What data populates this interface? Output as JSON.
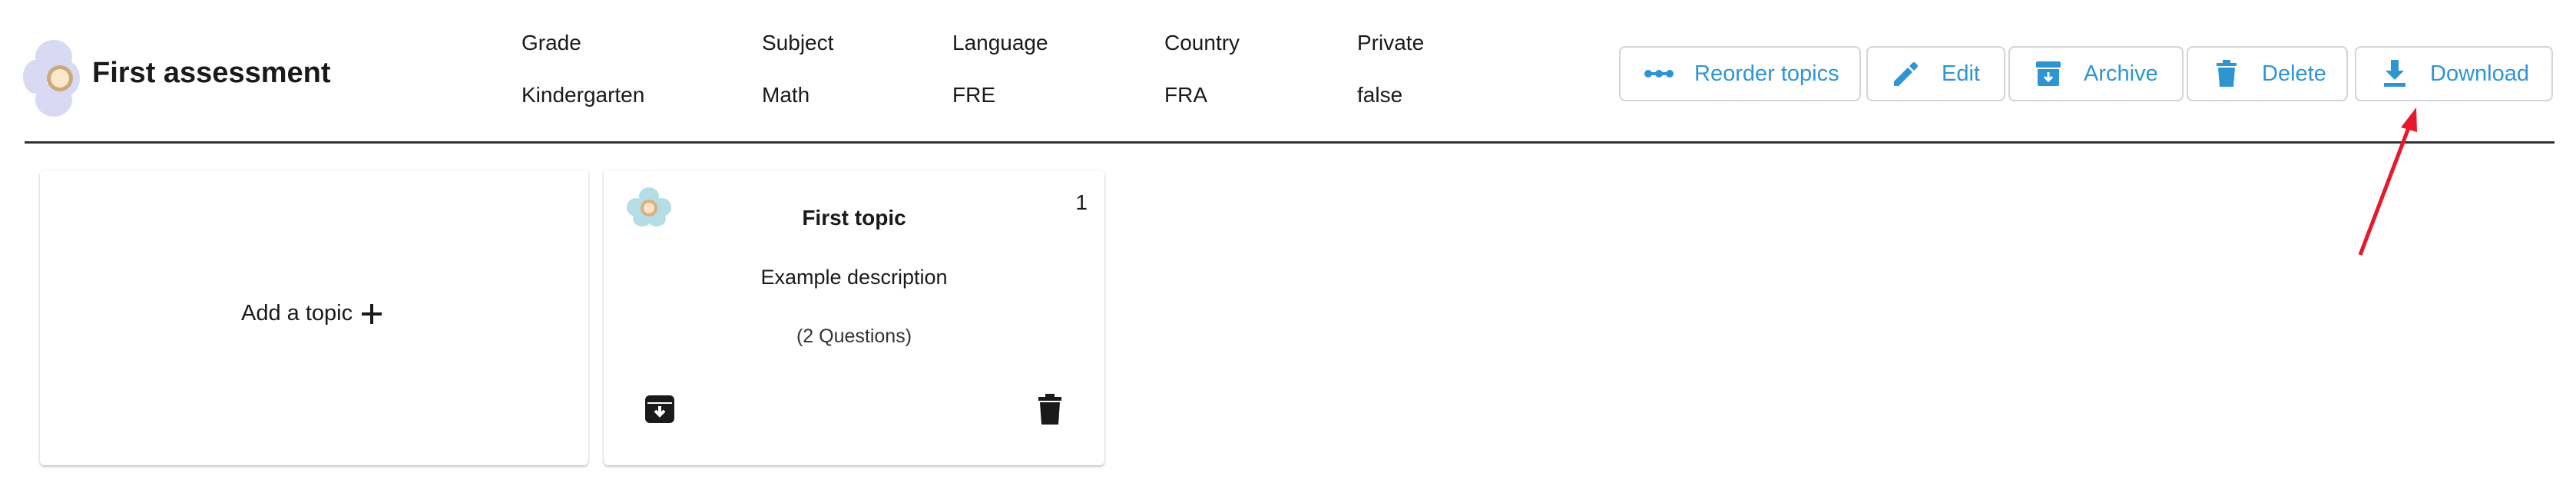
{
  "header": {
    "title": "First assessment",
    "meta": [
      {
        "label": "Grade",
        "value": "Kindergarten"
      },
      {
        "label": "Subject",
        "value": "Math"
      },
      {
        "label": "Language",
        "value": "FRE"
      },
      {
        "label": "Country",
        "value": "FRA"
      },
      {
        "label": "Private",
        "value": "false"
      }
    ]
  },
  "toolbar": {
    "reorder_label": "Reorder topics",
    "edit_label": "Edit",
    "archive_label": "Archive",
    "delete_label": "Delete",
    "download_label": "Download"
  },
  "add_topic": {
    "label": "Add a topic"
  },
  "topics": [
    {
      "title": "First topic",
      "description": "Example description",
      "questions": "(2 Questions)",
      "number": "1"
    }
  ],
  "colors": {
    "accent": "#2e95d3",
    "annotation_arrow": "#e8182b"
  },
  "icons": {
    "reorder": "reorder-icon",
    "edit": "pencil-icon",
    "archive": "archive-icon",
    "delete": "trash-icon",
    "download": "download-icon",
    "add": "plus-icon",
    "logo": "flower-logo-icon"
  }
}
